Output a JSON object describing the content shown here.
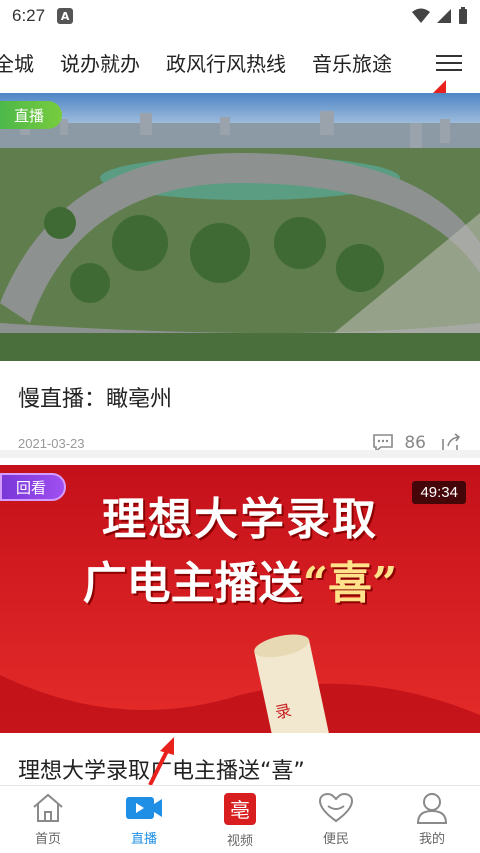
{
  "status_bar": {
    "time": "6:27",
    "notification_icon": "A"
  },
  "top_tabs": [
    "全城",
    "说办就办",
    "政风行风热线",
    "音乐旅途"
  ],
  "menu_icon": "hamburger-menu-icon",
  "feed": [
    {
      "badge": "直播",
      "title": "慢直播：瞰亳州",
      "date": "2021-03-23",
      "comment_count": "86"
    },
    {
      "badge": "回看",
      "duration": "49:34",
      "poster_line1": "理想大学录取",
      "poster_line2": "广电主播送",
      "poster_highlight": "“喜”",
      "title": "理想大学录取广电主播送“喜”"
    }
  ],
  "bottom_nav": [
    {
      "label": "首页",
      "icon": "home-icon"
    },
    {
      "label": "直播",
      "icon": "live-video-icon",
      "active": true
    },
    {
      "label": "视频",
      "icon": "video-logo-icon"
    },
    {
      "label": "便民",
      "icon": "heart-icon"
    },
    {
      "label": "我的",
      "icon": "user-icon"
    }
  ],
  "colors": {
    "accent": "#1f8fe5",
    "live_badge": "#5cbf45",
    "replay_badge": "#8b3fe5",
    "poster_red": "#d81e1e"
  }
}
